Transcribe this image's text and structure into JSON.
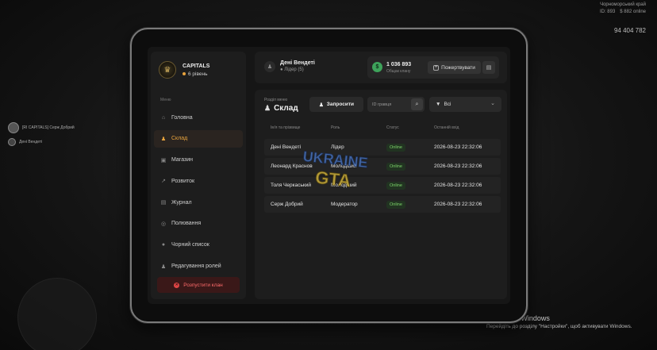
{
  "hud": {
    "server_label": "Чорноморський край",
    "money": "94 404 782",
    "stat_a": "ID: 893",
    "stat_b": "$ 882 online"
  },
  "chat": {
    "lines": [
      "[RI CAPITALS] Серж Добрий",
      "Дені Вендеті"
    ]
  },
  "windows_activation": {
    "title": "Активація Windows",
    "subtitle": "Перейдіть до розділу \"Настройки\", щоб активувати Windows."
  },
  "clan": {
    "name": "CAPITALS",
    "level": "6 рівень"
  },
  "sidebar": {
    "menu_caption": "Меню",
    "items": [
      {
        "label": "Головна",
        "icon": "home-icon"
      },
      {
        "label": "Склад",
        "icon": "people-icon"
      },
      {
        "label": "Магазин",
        "icon": "shop-icon"
      },
      {
        "label": "Розвиток",
        "icon": "chart-icon"
      },
      {
        "label": "Журнал",
        "icon": "journal-icon"
      },
      {
        "label": "Полювання",
        "icon": "target-icon"
      },
      {
        "label": "Чорний список",
        "icon": "blacklist-icon"
      },
      {
        "label": "Редагування ролей",
        "icon": "user-edit-icon"
      }
    ],
    "active": "Склад",
    "disband_label": "Розпустити клан"
  },
  "topbar": {
    "user_name": "Дені Вендеті",
    "user_rank": "Лідер (5)",
    "balance_amount": "1 036 893",
    "balance_caption": "Общак клану",
    "donate_label": "Пожертвувати"
  },
  "main": {
    "breadcrumb": "Розділ меню",
    "title": "Склад",
    "invite_label": "Запросити",
    "search_placeholder": "ID гравця",
    "filter_value": "Всі",
    "columns": [
      "Ім'я та прізвище",
      "Роль",
      "Статус",
      "Останній вхід"
    ],
    "rows": [
      {
        "name": "Дені Вендеті",
        "role": "Лідер",
        "status": "Online",
        "last": "2026-08-23 22:32:06"
      },
      {
        "name": "Леонард Краснов",
        "role": "Молодший",
        "status": "Online",
        "last": "2026-08-23 22:32:06"
      },
      {
        "name": "Толя Черкаський",
        "role": "Молодший",
        "status": "Online",
        "last": "2026-08-23 22:32:06"
      },
      {
        "name": "Серж Добрий",
        "role": "Модератор",
        "status": "Online",
        "last": "2026-08-23 22:32:06"
      }
    ]
  },
  "watermark": {
    "line1": "UKRAINE",
    "line2": "GTA"
  },
  "colors": {
    "accent": "#e8a33d",
    "online": "#7fd66b",
    "danger": "#e04545",
    "coin": "#3ea35b"
  }
}
